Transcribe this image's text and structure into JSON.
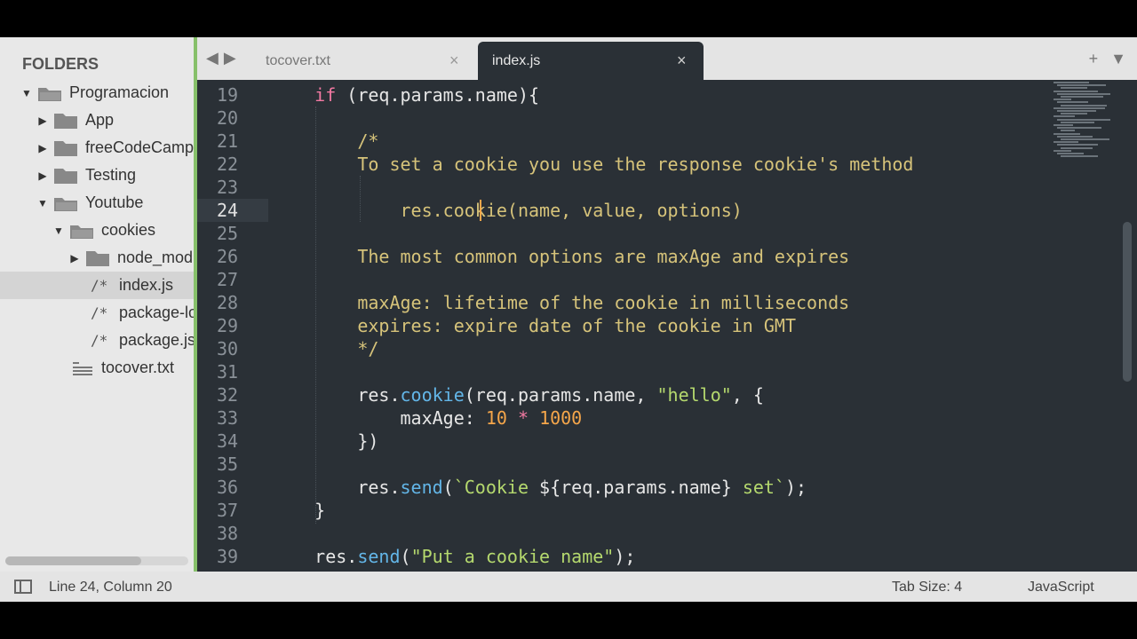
{
  "sidebar": {
    "heading": "FOLDERS",
    "items": [
      {
        "label": "Programacion",
        "type": "folder",
        "expanded": true
      },
      {
        "label": "App",
        "type": "folder",
        "expanded": false
      },
      {
        "label": "freeCodeCamp",
        "type": "folder",
        "expanded": false
      },
      {
        "label": "Testing",
        "type": "folder",
        "expanded": false
      },
      {
        "label": "Youtube",
        "type": "folder",
        "expanded": true
      },
      {
        "label": "cookies",
        "type": "folder",
        "expanded": true
      },
      {
        "label": "node_mod",
        "type": "folder",
        "expanded": false
      },
      {
        "label": "index.js",
        "type": "file",
        "icon_text": "/*"
      },
      {
        "label": "package-lo",
        "type": "file",
        "icon_text": "/*"
      },
      {
        "label": "package.jso",
        "type": "file",
        "icon_text": "/*"
      },
      {
        "label": "tocover.txt",
        "type": "text-file"
      }
    ]
  },
  "tabs": [
    {
      "label": "tocover.txt",
      "close": "×",
      "active": false
    },
    {
      "label": "index.js",
      "close": "×",
      "active": true
    }
  ],
  "tabbar": {
    "back": "◀",
    "forward": "▶",
    "new_tab": "+",
    "menu": "▼"
  },
  "editor": {
    "line_numbers": [
      "19",
      "20",
      "21",
      "22",
      "23",
      "24",
      "25",
      "26",
      "27",
      "28",
      "29",
      "30",
      "31",
      "32",
      "33",
      "34",
      "35",
      "36",
      "37",
      "38",
      "39"
    ],
    "current_line": "24"
  },
  "status": {
    "position": "Line 24, Column 20",
    "tab_size": "Tab Size: 4",
    "syntax": "JavaScript"
  },
  "colors": {
    "editor_bg": "#2a3036",
    "keyword": "#f279a2",
    "comment": "#d6c37a",
    "function": "#63b6e8",
    "string": "#b5d96e",
    "number": "#f5a64a",
    "sidebar_accent": "#86c06a"
  }
}
